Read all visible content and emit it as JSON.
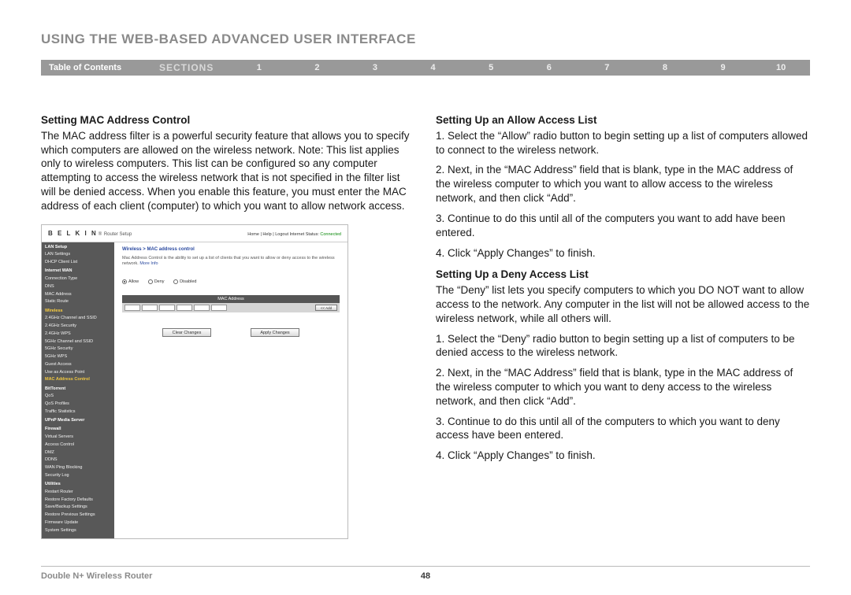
{
  "page_heading": "USING THE WEB-BASED ADVANCED USER INTERFACE",
  "sections_bar": {
    "toc": "Table of Contents",
    "label": "SECTIONS",
    "numbers": [
      "1",
      "2",
      "3",
      "4",
      "5",
      "6",
      "7",
      "8",
      "9",
      "10"
    ],
    "active": "6"
  },
  "left": {
    "h1": "Setting MAC Address Control",
    "p1": "The MAC address filter is a powerful security feature that allows you to specify which computers are allowed on the wireless network. Note: This list applies only to wireless computers. This list can be configured so any computer attempting to access the wireless network that is not specified in the filter list will be denied access. When you enable this feature, you must enter the MAC address of each client (computer) to which you want to allow network access."
  },
  "right": {
    "h1": "Setting Up an Allow Access List",
    "p1": "1. Select the “Allow” radio button to begin setting up a list of computers allowed to connect to the wireless network.",
    "p2": "2. Next, in the “MAC Address” field that is blank, type in the MAC address of the wireless computer to which you want to allow access to the wireless network, and then click “Add”.",
    "p3": "3. Continue to do this until all of the computers you want to add have been entered.",
    "p4": "4. Click “Apply Changes” to finish.",
    "h2": "Setting Up a Deny Access List",
    "p5": "The “Deny” list lets you specify computers to which you DO NOT want to allow access to the network. Any computer in the list will not be allowed access to the wireless network, while all others will.",
    "p6": "1. Select the “Deny” radio button to begin setting up a list of computers to be denied access to the wireless network.",
    "p7": "2. Next, in the “MAC Address” field that is blank, type in the MAC address of the wireless computer to which you want to deny access to the wireless network, and then click “Add”.",
    "p8": "3. Continue to do this until all of the computers to which you want to deny access have been entered.",
    "p9": "4. Click “Apply Changes” to finish."
  },
  "router": {
    "brand": "B E L K I N",
    "brand_tag": "Router Setup",
    "toplinks": "Home | Help | Logout  Internet Status:",
    "connected": "Connected",
    "nav": {
      "groups": [
        {
          "head": "LAN Setup",
          "items": [
            "LAN Settings",
            "DHCP Client List"
          ]
        },
        {
          "head": "Internet WAN",
          "items": [
            "Connection Type",
            "DNS",
            "MAC Address",
            "Static Route"
          ]
        },
        {
          "head_yellow": "Wireless",
          "items": [
            "2.4GHz Channel and SSID",
            "2.4GHz Security",
            "2.4GHz WPS",
            "5GHz Channel and SSID",
            "5GHz Security",
            "5GHz WPS",
            "Guest Access",
            "Use as Access Point"
          ]
        },
        {
          "head_yellow_item": "MAC Address Control"
        },
        {
          "head": "BitTorrent",
          "items": [
            "QoS",
            "QoS Profiles",
            "Traffic Statistics"
          ]
        },
        {
          "head": "UPnP Media Server",
          "items": []
        },
        {
          "head": "Firewall",
          "items": [
            "Virtual Servers",
            "Access Control",
            "DMZ",
            "DDNS",
            "WAN Ping Blocking",
            "Security Log"
          ]
        },
        {
          "head": "Utilities",
          "items": [
            "Restart Router",
            "Restore Factory Defaults",
            "Save/Backup Settings",
            "Restore Previous Settings",
            "Firmware Update",
            "System Settings"
          ]
        }
      ]
    },
    "main": {
      "breadcrumb": "Wireless > MAC address control",
      "desc": "Mac Address Control is the ability to set up a list of clients that you want to allow or deny access to the wireless network.",
      "more": "More Info",
      "radios": {
        "allow": "Allow",
        "deny": "Deny",
        "disabled": "Disabled"
      },
      "macbar": "MAC Address",
      "addbtn": "<< Add",
      "clear": "Clear Changes",
      "apply": "Apply Changes"
    }
  },
  "footer": {
    "product": "Double N+ Wireless Router",
    "page": "48"
  }
}
